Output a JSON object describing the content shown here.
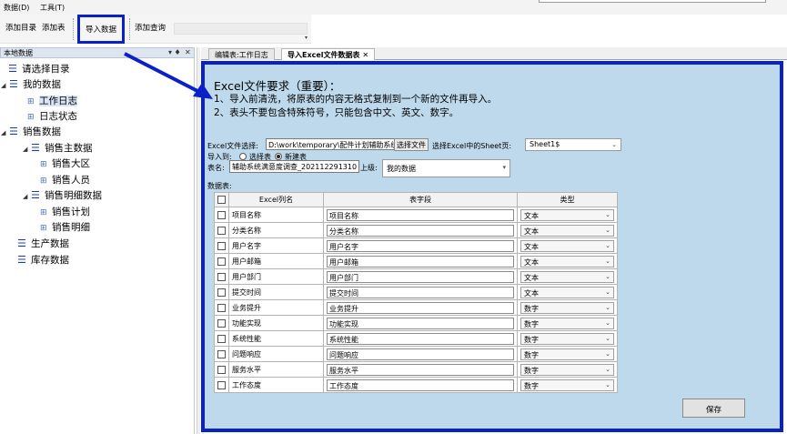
{
  "menu": {
    "data": "数据(D)",
    "tools": "工具(T)"
  },
  "toolbar": {
    "add_directory": "添加目录",
    "add_table": "添加表",
    "import_data": "导入数据",
    "add_query": "添加查询"
  },
  "panel": {
    "title": "本地数据",
    "pin": "▾ ♦",
    "close": "✕"
  },
  "tree": {
    "items": [
      {
        "label": "请选择目录"
      },
      {
        "label": "我的数据"
      },
      {
        "label": "工作日志"
      },
      {
        "label": "日志状态"
      },
      {
        "label": "销售数据"
      },
      {
        "label": "销售主数据"
      },
      {
        "label": "销售大区"
      },
      {
        "label": "销售人员"
      },
      {
        "label": "销售明细数据"
      },
      {
        "label": "销售计划"
      },
      {
        "label": "销售明细"
      },
      {
        "label": "生产数据"
      },
      {
        "label": "库存数据"
      }
    ]
  },
  "tabs": [
    {
      "label": "编辑表:工作日志"
    },
    {
      "label": "导入Excel文件数据表"
    }
  ],
  "tab_close": "✕",
  "requirements": {
    "title": "Excel文件要求（重要）：",
    "line1": "1、导入前清洗，将原表的内容无格式复制到一个新的文件再导入。",
    "line2": "2、表头不要包含特殊符号，只能包含中文、英文、数字。"
  },
  "form": {
    "file_label": "Excel文件选择:",
    "file_path": "D:\\work\\temporary\\配件计划辅助系统",
    "choose_file": "选择文件",
    "sheet_label": "选择Excel中的Sheet页:",
    "sheet_value": "Sheet1$",
    "import_to_label": "导入到:",
    "option_existing": "选择表",
    "option_new": "新建表",
    "table_name_label": "表名:",
    "table_name_value": "辅助系统满意度调查_202112291310",
    "parent_label": "上级:",
    "parent_value": "我的数据",
    "data_table_label": "数据表:"
  },
  "grid": {
    "headers": {
      "excel_col": "Excel列名",
      "field": "表字段",
      "type": "类型"
    },
    "rows": [
      {
        "excel": "项目名称",
        "field": "项目名称",
        "type": "文本"
      },
      {
        "excel": "分类名称",
        "field": "分类名称",
        "type": "文本"
      },
      {
        "excel": "用户名字",
        "field": "用户名字",
        "type": "文本"
      },
      {
        "excel": "用户邮箱",
        "field": "用户邮箱",
        "type": "文本"
      },
      {
        "excel": "用户部门",
        "field": "用户部门",
        "type": "文本"
      },
      {
        "excel": "提交时间",
        "field": "提交时间",
        "type": "文本"
      },
      {
        "excel": "业务提升",
        "field": "业务提升",
        "type": "数字"
      },
      {
        "excel": "功能实现",
        "field": "功能实现",
        "type": "数字"
      },
      {
        "excel": "系统性能",
        "field": "系统性能",
        "type": "数字"
      },
      {
        "excel": "问题响应",
        "field": "问题响应",
        "type": "数字"
      },
      {
        "excel": "服务水平",
        "field": "服务水平",
        "type": "数字"
      },
      {
        "excel": "工作态度",
        "field": "工作态度",
        "type": "数字"
      }
    ]
  },
  "save": "保存",
  "colors": {
    "highlight": "#0a20c8",
    "content_bg": "#bed9ec",
    "tree_icon": "#1f3f9e"
  },
  "icons": {
    "list": "list-icon",
    "table": "table-icon",
    "expand": "expand-triangle-icon",
    "dropdown": "chevron-down-icon"
  }
}
